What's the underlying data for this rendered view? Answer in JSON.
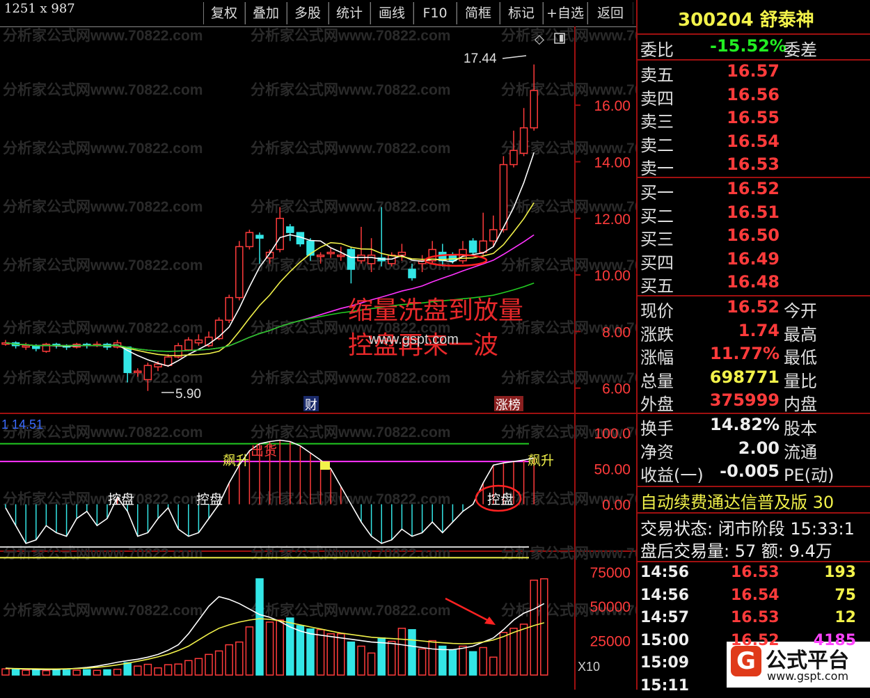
{
  "window": {
    "size_label": "1251 x 987"
  },
  "toolbar": {
    "buttons": [
      "复权",
      "叠加",
      "多股",
      "统计",
      "画线",
      "F10",
      "简框",
      "标记",
      "+自选",
      "返回"
    ]
  },
  "stock": {
    "code_name": "300204 舒泰神"
  },
  "order_book": {
    "ratio_label": "委比",
    "ratio_value": "-15.52%",
    "diff_label": "委差",
    "sells": [
      {
        "label": "卖五",
        "price": "16.57"
      },
      {
        "label": "卖四",
        "price": "16.56"
      },
      {
        "label": "卖三",
        "price": "16.55"
      },
      {
        "label": "卖二",
        "price": "16.54"
      },
      {
        "label": "卖一",
        "price": "16.53"
      }
    ],
    "buys": [
      {
        "label": "买一",
        "price": "16.52"
      },
      {
        "label": "买二",
        "price": "16.51"
      },
      {
        "label": "买三",
        "price": "16.50"
      },
      {
        "label": "买四",
        "price": "16.49"
      },
      {
        "label": "买五",
        "price": "16.48"
      }
    ]
  },
  "quote": [
    {
      "label": "现价",
      "value": "16.52",
      "color": "#ff3b3b",
      "label2": "今开"
    },
    {
      "label": "涨跌",
      "value": "1.74",
      "color": "#ff3b3b",
      "label2": "最高"
    },
    {
      "label": "涨幅",
      "value": "11.77%",
      "color": "#ff3b3b",
      "label2": "最低"
    },
    {
      "label": "总量",
      "value": "698771",
      "color": "#f2f24a",
      "label2": "量比"
    },
    {
      "label": "外盘",
      "value": "375999",
      "color": "#ff3b3b",
      "label2": "内盘"
    }
  ],
  "fundamentals": [
    {
      "label": "换手",
      "value": "14.82%",
      "label2": "股本"
    },
    {
      "label": "净资",
      "value": "2.00",
      "label2": "流通"
    },
    {
      "label": "收益(一)",
      "value": "-0.005",
      "label2": "PE(动)"
    }
  ],
  "ad_banner": "自动续费通达信普及版 30",
  "status": {
    "trade_status": "交易状态: 闭市阶段 15:33:1",
    "after_hours": "盘后交易量: 57 额: 9.4万"
  },
  "ticks": [
    {
      "time": "14:56",
      "price": "16.53",
      "vol": "193",
      "vol_color": "#f2f24a"
    },
    {
      "time": "14:56",
      "price": "16.54",
      "vol": "75",
      "vol_color": "#f2f24a"
    },
    {
      "time": "14:57",
      "price": "16.53",
      "vol": "12",
      "vol_color": "#f2f24a"
    },
    {
      "time": "15:00",
      "price": "16.52",
      "vol": "4185",
      "vol_color": "#ff44ff"
    },
    {
      "time": "15:09",
      "price": "",
      "vol": "",
      "vol_color": "#f2f24a"
    },
    {
      "time": "15:11",
      "price": "",
      "vol": "",
      "vol_color": "#f2f24a"
    }
  ],
  "logo": {
    "text": "公式平台",
    "url": "www.gspt.com"
  },
  "chart": {
    "watermark": "分析家公式网www.70822.com",
    "price_axis": [
      "16.00",
      "14.00",
      "12.00",
      "10.00",
      "8.00",
      "6.00"
    ],
    "high_label": "17.44",
    "low_label": "5.90",
    "annotation_line1": "缩量洗盘到放量",
    "annotation_line2": "控盘再来一波",
    "annotation_watermark": "www.gspt.com",
    "event_cai": "财",
    "event_zhangbang": "涨榜",
    "indicator_value": "1 14.51",
    "indicator_axis": [
      "100.0",
      "50.00",
      "0.00"
    ],
    "indicator_labels": {
      "kongpan": "控盘",
      "piaosheng": "飙升",
      "chuhuo": "出货"
    },
    "volume_axis": [
      "75000",
      "50000",
      "25000"
    ],
    "volume_unit": "X10",
    "colors": {
      "up": "#ff3b3b",
      "down": "#33e6e6",
      "ma_white": "#ffffff",
      "ma_yellow": "#f2f24a",
      "ma_magenta": "#ff33ff",
      "ma_green": "#22cc22"
    }
  },
  "chart_data": {
    "type": "candlestick",
    "price_ylim": [
      5.5,
      17.8
    ],
    "candles": [
      [
        7.55,
        7.6,
        7.5,
        7.7
      ],
      [
        7.6,
        7.5,
        7.4,
        7.65
      ],
      [
        7.45,
        7.5,
        7.35,
        7.6
      ],
      [
        7.5,
        7.4,
        7.3,
        7.55
      ],
      [
        7.3,
        7.55,
        7.25,
        7.6
      ],
      [
        7.55,
        7.5,
        7.4,
        7.6
      ],
      [
        7.5,
        7.45,
        7.35,
        7.55
      ],
      [
        7.45,
        7.55,
        7.4,
        7.6
      ],
      [
        7.55,
        7.5,
        7.4,
        7.6
      ],
      [
        7.5,
        7.55,
        7.45,
        7.65
      ],
      [
        7.55,
        7.45,
        7.35,
        7.6
      ],
      [
        7.45,
        7.6,
        7.4,
        7.7
      ],
      [
        7.45,
        6.55,
        6.2,
        7.45
      ],
      [
        6.55,
        6.6,
        6.4,
        6.7
      ],
      [
        6.3,
        6.8,
        5.9,
        6.9
      ],
      [
        6.75,
        6.85,
        6.6,
        6.95
      ],
      [
        6.8,
        7.1,
        6.75,
        7.2
      ],
      [
        7.1,
        7.5,
        7.05,
        7.6
      ],
      [
        7.35,
        7.7,
        7.3,
        7.8
      ],
      [
        7.6,
        7.7,
        7.5,
        7.9
      ],
      [
        7.5,
        7.8,
        7.45,
        8.0
      ],
      [
        7.75,
        8.4,
        7.7,
        8.5
      ],
      [
        8.4,
        9.2,
        8.3,
        9.3
      ],
      [
        9.2,
        11.0,
        9.1,
        11.2
      ],
      [
        11.0,
        11.5,
        10.9,
        11.6
      ],
      [
        11.4,
        11.3,
        10.4,
        11.5
      ],
      [
        10.6,
        10.8,
        10.4,
        10.9
      ],
      [
        10.9,
        12.0,
        10.8,
        12.4
      ],
      [
        11.7,
        11.5,
        11.2,
        11.8
      ],
      [
        11.5,
        11.1,
        11.0,
        11.3
      ],
      [
        11.2,
        10.7,
        10.5,
        11.3
      ],
      [
        10.7,
        10.7,
        10.4,
        10.8
      ],
      [
        10.8,
        10.8,
        10.6,
        10.95
      ],
      [
        10.7,
        10.7,
        10.5,
        11.0
      ],
      [
        10.9,
        10.2,
        9.7,
        11.0
      ],
      [
        10.5,
        10.7,
        10.4,
        11.7
      ],
      [
        10.4,
        10.7,
        10.1,
        11.3
      ],
      [
        10.6,
        10.5,
        10.3,
        12.4
      ],
      [
        10.4,
        10.7,
        10.3,
        10.8
      ],
      [
        10.7,
        10.8,
        10.5,
        11.1
      ],
      [
        10.2,
        9.9,
        9.8,
        10.4
      ],
      [
        10.4,
        10.5,
        10.1,
        10.7
      ],
      [
        10.5,
        10.9,
        10.4,
        11.2
      ],
      [
        10.8,
        10.5,
        10.3,
        11.1
      ],
      [
        10.7,
        10.5,
        10.4,
        10.8
      ],
      [
        10.5,
        10.9,
        10.4,
        11.2
      ],
      [
        11.2,
        10.8,
        10.7,
        11.3
      ],
      [
        10.8,
        11.2,
        10.7,
        12.2
      ],
      [
        11.2,
        11.6,
        11.0,
        12.1
      ],
      [
        11.6,
        13.9,
        11.5,
        14.2
      ],
      [
        13.9,
        14.4,
        13.8,
        15.1
      ],
      [
        14.3,
        15.2,
        14.2,
        15.9
      ],
      [
        15.2,
        16.52,
        15.1,
        17.44
      ]
    ],
    "indicator_ylim": [
      -60,
      110
    ],
    "indicator_line": [
      -5,
      -30,
      -55,
      -50,
      -30,
      -40,
      -45,
      -20,
      -10,
      -30,
      -20,
      10,
      -10,
      -45,
      -40,
      -20,
      -5,
      -35,
      -45,
      -40,
      -20,
      0,
      30,
      55,
      75,
      85,
      88,
      90,
      88,
      82,
      72,
      62,
      50,
      25,
      0,
      -25,
      -45,
      -55,
      -50,
      -35,
      -45,
      -40,
      -25,
      -40,
      -25,
      -10,
      0,
      30,
      55,
      58,
      60,
      62,
      65
    ],
    "volume_ylim": [
      0,
      82000
    ],
    "volumes": [
      4500,
      4000,
      3500,
      3800,
      3200,
      4000,
      3600,
      3500,
      3900,
      3400,
      3800,
      4200,
      9000,
      6500,
      7800,
      5200,
      7500,
      8000,
      10500,
      12000,
      15000,
      17500,
      22000,
      24000,
      35000,
      70000,
      38500,
      40000,
      41500,
      36000,
      33500,
      33000,
      30000,
      30000,
      24000,
      21000,
      16000,
      27000,
      24500,
      34000,
      33000,
      19000,
      25000,
      21000,
      18000,
      21000,
      17000,
      20000,
      13000,
      31000,
      34000,
      37000,
      69000,
      70000
    ],
    "volume_ma_white": [
      5000,
      4600,
      4300,
      4100,
      4000,
      4100,
      4400,
      4900,
      5500,
      6500,
      7800,
      9300,
      10500,
      11500,
      13000,
      15000,
      18000,
      22000,
      30000,
      40000,
      50000,
      57000,
      55000,
      52000,
      48000,
      44000,
      42000,
      39000,
      35000,
      32000,
      30000,
      29000,
      28000,
      27000,
      26000,
      25000,
      24000,
      23500,
      23000,
      22000,
      21000,
      20000,
      19000,
      18500,
      18500,
      19500,
      21000,
      24000,
      27000,
      33000,
      40000,
      45000,
      48000,
      52000
    ],
    "volume_ma_yellow": [
      4800,
      4700,
      4600,
      4500,
      4400,
      4400,
      4500,
      4700,
      5000,
      5600,
      6400,
      7400,
      8600,
      10000,
      11500,
      13200,
      15200,
      17800,
      21000,
      25500,
      30000,
      34000,
      36500,
      38500,
      40000,
      41000,
      40500,
      39500,
      38000,
      36500,
      35000,
      33500,
      32000,
      30500,
      29500,
      28500,
      27500,
      27000,
      26500,
      26000,
      25500,
      24800,
      24000,
      23500,
      23000,
      22800,
      23000,
      24000,
      25500,
      28000,
      31000,
      33500,
      36000,
      38000
    ]
  }
}
